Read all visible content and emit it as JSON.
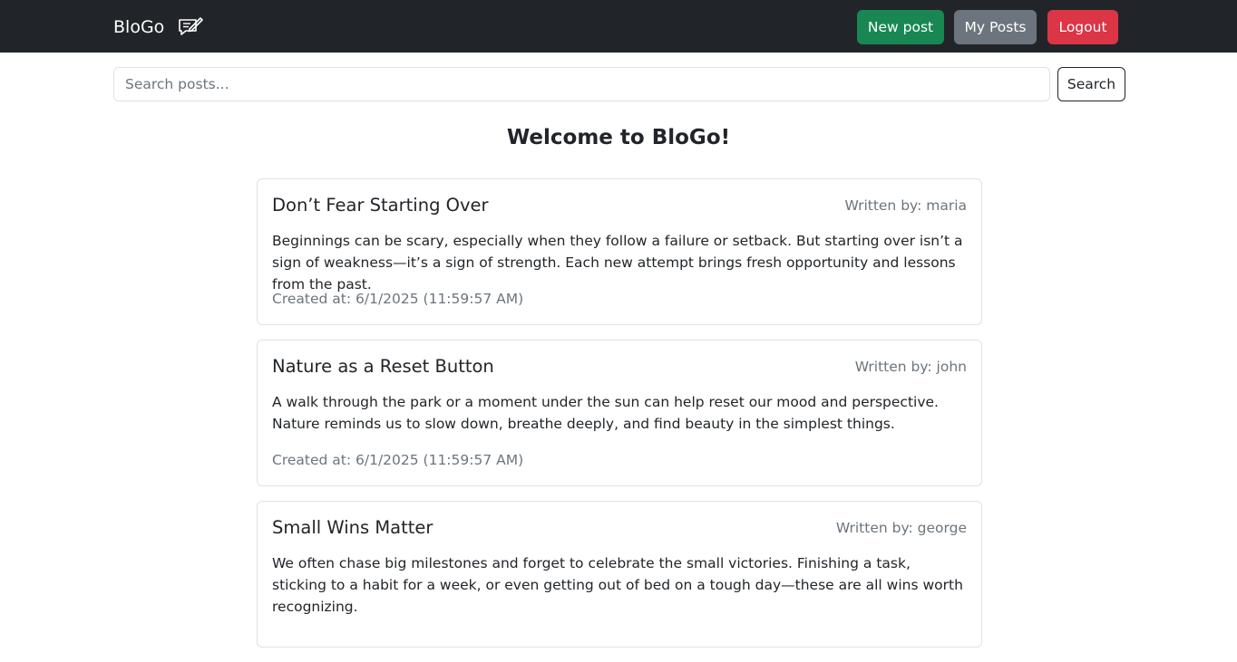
{
  "navbar": {
    "brand": "BloGo",
    "brand_icon": "pen-note-icon",
    "buttons": {
      "new_post": "New post",
      "my_posts": "My Posts",
      "logout": "Logout"
    },
    "colors": {
      "background": "#212529",
      "new_post": "#198754",
      "my_posts": "#6c757d",
      "logout": "#dc3545"
    }
  },
  "search": {
    "placeholder": "Search posts...",
    "value": "",
    "button_label": "Search"
  },
  "page_title": "Welcome to BloGo!",
  "posts": [
    {
      "title": "Don’t Fear Starting Over",
      "author": "Written by: maria",
      "body": "Beginnings can be scary, especially when they follow a failure or setback. But starting over isn’t a sign of weakness—it’s a sign of strength. Each new attempt brings fresh opportunity and lessons from the past.",
      "created": "Created at: 6/1/2025 (11:59:57 AM)"
    },
    {
      "title": "Nature as a Reset Button",
      "author": "Written by: john",
      "body": "A walk through the park or a moment under the sun can help reset our mood and perspective. Nature reminds us to slow down, breathe deeply, and find beauty in the simplest things.",
      "created": "Created at: 6/1/2025 (11:59:57 AM)"
    },
    {
      "title": "Small Wins Matter",
      "author": "Written by: george",
      "body": "We often chase big milestones and forget to celebrate the small victories. Finishing a task, sticking to a habit for a week, or even getting out of bed on a tough day—these are all wins worth recognizing.",
      "created": ""
    }
  ]
}
